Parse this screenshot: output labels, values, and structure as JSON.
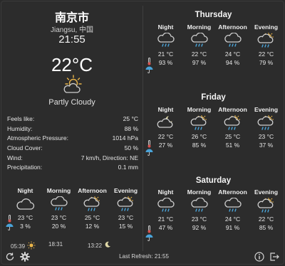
{
  "location": {
    "city": "南京市",
    "region": "Jiangsu, 中国"
  },
  "current": {
    "time": "21:55",
    "temperature": "22°C",
    "condition": "Partly Cloudy",
    "condition_icon": "partly-cloudy-icon"
  },
  "details": [
    {
      "label": "Feels like:",
      "value": "25 °C"
    },
    {
      "label": "Humidity:",
      "value": "88 %"
    },
    {
      "label": "Atmospheric Pressure:",
      "value": "1014 hPa"
    },
    {
      "label": "Cloud Cover:",
      "value": "50 %"
    },
    {
      "label": "Wind:",
      "value": "7 km/h, Direction: NE"
    },
    {
      "label": "Precipitation:",
      "value": "0.1 mm"
    }
  ],
  "today": {
    "periods": [
      {
        "label": "Night",
        "icon": "cloud-icon",
        "temp": "23 °C",
        "precip": "3 %"
      },
      {
        "label": "Morning",
        "icon": "rain-cloud-icon",
        "temp": "23 °C",
        "precip": "20 %"
      },
      {
        "label": "Afternoon",
        "icon": "sun-rain-cloud-icon",
        "temp": "25 °C",
        "precip": "12 %"
      },
      {
        "label": "Evening",
        "icon": "sun-rain-cloud-icon",
        "temp": "23 °C",
        "precip": "15 %"
      }
    ]
  },
  "days": [
    {
      "title": "Thursday",
      "periods": [
        {
          "label": "Night",
          "icon": "rain-cloud-icon",
          "temp": "21 °C",
          "precip": "93 %"
        },
        {
          "label": "Morning",
          "icon": "rain-cloud-icon",
          "temp": "22 °C",
          "precip": "97 %"
        },
        {
          "label": "Afternoon",
          "icon": "rain-cloud-icon",
          "temp": "24 °C",
          "precip": "94 %"
        },
        {
          "label": "Evening",
          "icon": "sun-rain-cloud-icon",
          "temp": "22 °C",
          "precip": "79 %"
        }
      ]
    },
    {
      "title": "Friday",
      "periods": [
        {
          "label": "Night",
          "icon": "moon-cloud-icon",
          "temp": "22 °C",
          "precip": "27 %"
        },
        {
          "label": "Morning",
          "icon": "sun-rain-cloud-icon",
          "temp": "26 °C",
          "precip": "85 %"
        },
        {
          "label": "Afternoon",
          "icon": "sun-rain-cloud-icon",
          "temp": "25 °C",
          "precip": "51 %"
        },
        {
          "label": "Evening",
          "icon": "sun-rain-cloud-icon",
          "temp": "23 °C",
          "precip": "37 %"
        }
      ]
    },
    {
      "title": "Saturday",
      "periods": [
        {
          "label": "Night",
          "icon": "rain-cloud-icon",
          "temp": "21 °C",
          "precip": "47 %"
        },
        {
          "label": "Morning",
          "icon": "rain-cloud-icon",
          "temp": "23 °C",
          "precip": "92 %"
        },
        {
          "label": "Afternoon",
          "icon": "rain-cloud-icon",
          "temp": "24 °C",
          "precip": "91 %"
        },
        {
          "label": "Evening",
          "icon": "sun-rain-cloud-icon",
          "temp": "22 °C",
          "precip": "85 %"
        }
      ]
    }
  ],
  "status": {
    "sunrise": "05:39",
    "sunset": "18:31",
    "moonrise": "13:22",
    "last_refresh": "Last Refresh: 21:55"
  },
  "colors": {
    "background": "#2c2c2c",
    "text": "#e6e6e6",
    "accent_sun": "#e8b44a",
    "rain": "#4aa3d8"
  }
}
